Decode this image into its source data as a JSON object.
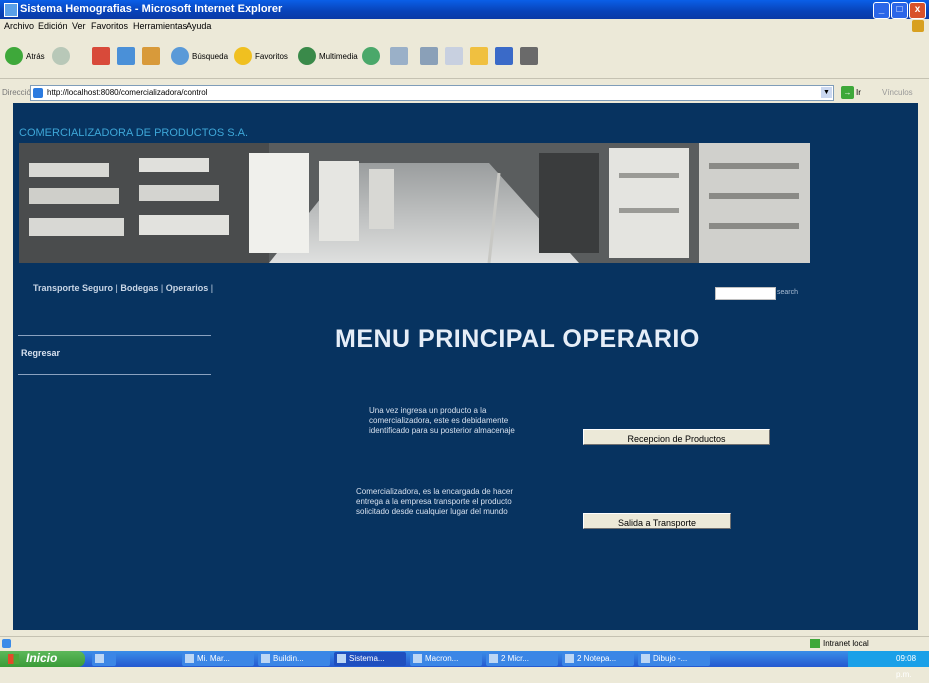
{
  "window": {
    "title": "Sistema Hemografias - Microsoft Internet Explorer",
    "min_label": "_",
    "max_label": "□",
    "close_label": "x"
  },
  "menubar": [
    "Archivo",
    "Edición",
    "Ver",
    "Favoritos",
    "Herramientas",
    "Ayuda"
  ],
  "toolbar": {
    "back_label": "Atrás",
    "search_label": "Búsqueda",
    "favorites_label": "Favoritos",
    "multimedia_label": "Multimedia"
  },
  "address": {
    "label": "Dirección",
    "url": "http://localhost:8080/comercializadora/control",
    "go_label": "Ir",
    "links_label": "Vínculos"
  },
  "page": {
    "company": "COMERCIALIZADORA DE PRODUCTOS S.A.",
    "nav": [
      "Transporte Seguro",
      "Bodegas",
      "Operarios"
    ],
    "search_label": "search",
    "search_value": "",
    "back_link": "Regresar",
    "title": "MENU PRINCIPAL OPERARIO",
    "desc1": "Una vez ingresa un producto a la comercializadora, este es debidamente identificado para su posterior almacenaje",
    "btn1": "Recepcion de Productos",
    "desc2": "Comercializadora, es la encargada de hacer entrega a la empresa transporte el producto solicitado desde cualquier lugar del mundo",
    "btn2": "Salida a Transporte"
  },
  "status": {
    "zone": "Intranet local"
  },
  "taskbar": {
    "start": "Inicio",
    "tasks": [
      "Mi. Mar...",
      "Buildin...",
      "Sistema...",
      "Macron...",
      "2 Micr...",
      "2 Notepa...",
      "Dibujo -..."
    ],
    "clock": "09:08 p.m."
  },
  "colors": {
    "page_bg": "#073360",
    "company": "#3ea7d8",
    "title": "#e6eef8"
  }
}
